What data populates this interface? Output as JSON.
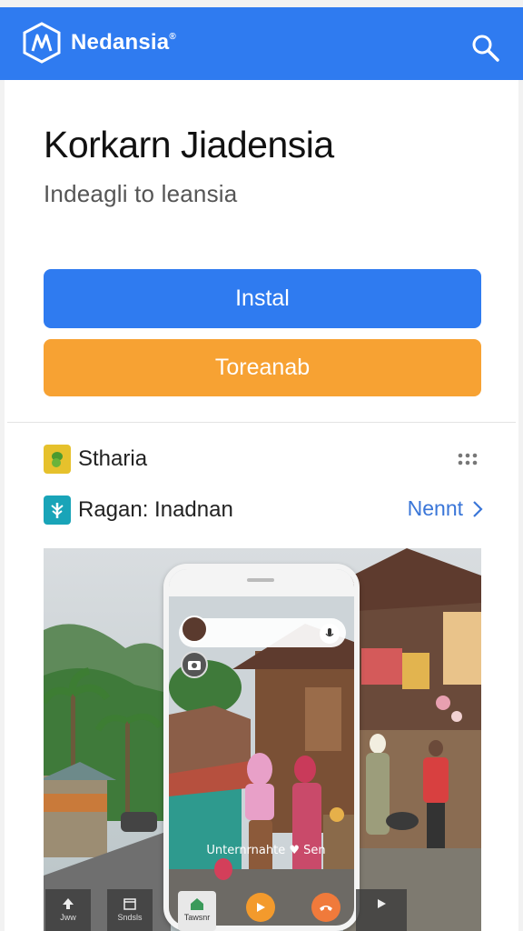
{
  "app": {
    "brand": "Nedansia",
    "brand_mark": "®"
  },
  "header": {
    "title": "Korkarn Jiadensia",
    "subtitle": "Indeagli to leansia"
  },
  "actions": {
    "install_label": "Instal",
    "secondary_label": "Toreanab"
  },
  "list": {
    "row1_label": "Stharia",
    "row2_label": "Ragan: Inadnan",
    "row2_link": "Nennt"
  },
  "screenshot_overlay": {
    "caption": "Unternrnahte ♥ Sen",
    "tile_a_label": "Jww",
    "tile_b_label": "Sndsls",
    "home_label": "Tawsnr",
    "tile_c_label": ""
  },
  "colors": {
    "app_bar": "#2f7bf0",
    "install": "#2f7bf0",
    "secondary": "#f7a233",
    "link": "#3a76d8"
  },
  "icons": {
    "logo": "brand-logo-icon",
    "search": "search-icon",
    "more": "more-dots-icon",
    "chevron": "chevron-right-icon"
  }
}
